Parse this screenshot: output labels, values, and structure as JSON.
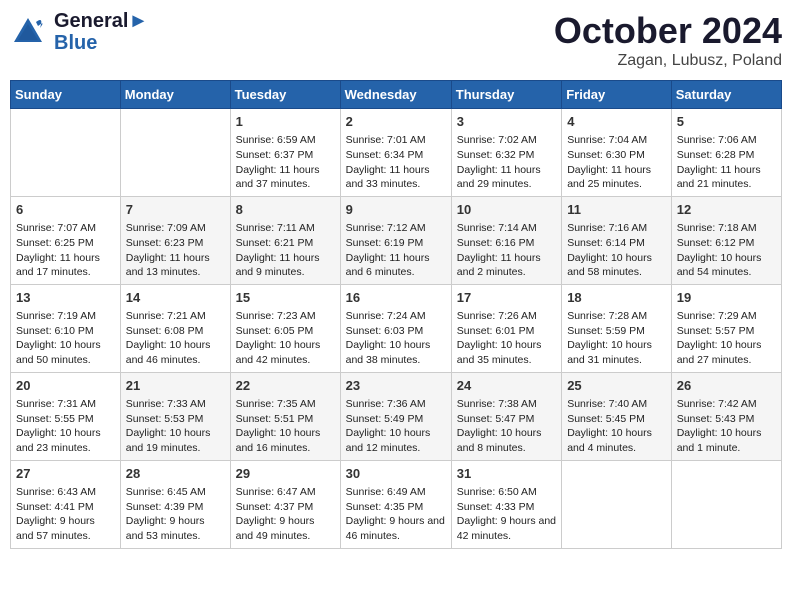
{
  "header": {
    "logo_general": "General",
    "logo_blue": "Blue",
    "month_title": "October 2024",
    "location": "Zagan, Lubusz, Poland"
  },
  "days_of_week": [
    "Sunday",
    "Monday",
    "Tuesday",
    "Wednesday",
    "Thursday",
    "Friday",
    "Saturday"
  ],
  "weeks": [
    [
      {
        "day": "",
        "info": ""
      },
      {
        "day": "",
        "info": ""
      },
      {
        "day": "1",
        "info": "Sunrise: 6:59 AM\nSunset: 6:37 PM\nDaylight: 11 hours and 37 minutes."
      },
      {
        "day": "2",
        "info": "Sunrise: 7:01 AM\nSunset: 6:34 PM\nDaylight: 11 hours and 33 minutes."
      },
      {
        "day": "3",
        "info": "Sunrise: 7:02 AM\nSunset: 6:32 PM\nDaylight: 11 hours and 29 minutes."
      },
      {
        "day": "4",
        "info": "Sunrise: 7:04 AM\nSunset: 6:30 PM\nDaylight: 11 hours and 25 minutes."
      },
      {
        "day": "5",
        "info": "Sunrise: 7:06 AM\nSunset: 6:28 PM\nDaylight: 11 hours and 21 minutes."
      }
    ],
    [
      {
        "day": "6",
        "info": "Sunrise: 7:07 AM\nSunset: 6:25 PM\nDaylight: 11 hours and 17 minutes."
      },
      {
        "day": "7",
        "info": "Sunrise: 7:09 AM\nSunset: 6:23 PM\nDaylight: 11 hours and 13 minutes."
      },
      {
        "day": "8",
        "info": "Sunrise: 7:11 AM\nSunset: 6:21 PM\nDaylight: 11 hours and 9 minutes."
      },
      {
        "day": "9",
        "info": "Sunrise: 7:12 AM\nSunset: 6:19 PM\nDaylight: 11 hours and 6 minutes."
      },
      {
        "day": "10",
        "info": "Sunrise: 7:14 AM\nSunset: 6:16 PM\nDaylight: 11 hours and 2 minutes."
      },
      {
        "day": "11",
        "info": "Sunrise: 7:16 AM\nSunset: 6:14 PM\nDaylight: 10 hours and 58 minutes."
      },
      {
        "day": "12",
        "info": "Sunrise: 7:18 AM\nSunset: 6:12 PM\nDaylight: 10 hours and 54 minutes."
      }
    ],
    [
      {
        "day": "13",
        "info": "Sunrise: 7:19 AM\nSunset: 6:10 PM\nDaylight: 10 hours and 50 minutes."
      },
      {
        "day": "14",
        "info": "Sunrise: 7:21 AM\nSunset: 6:08 PM\nDaylight: 10 hours and 46 minutes."
      },
      {
        "day": "15",
        "info": "Sunrise: 7:23 AM\nSunset: 6:05 PM\nDaylight: 10 hours and 42 minutes."
      },
      {
        "day": "16",
        "info": "Sunrise: 7:24 AM\nSunset: 6:03 PM\nDaylight: 10 hours and 38 minutes."
      },
      {
        "day": "17",
        "info": "Sunrise: 7:26 AM\nSunset: 6:01 PM\nDaylight: 10 hours and 35 minutes."
      },
      {
        "day": "18",
        "info": "Sunrise: 7:28 AM\nSunset: 5:59 PM\nDaylight: 10 hours and 31 minutes."
      },
      {
        "day": "19",
        "info": "Sunrise: 7:29 AM\nSunset: 5:57 PM\nDaylight: 10 hours and 27 minutes."
      }
    ],
    [
      {
        "day": "20",
        "info": "Sunrise: 7:31 AM\nSunset: 5:55 PM\nDaylight: 10 hours and 23 minutes."
      },
      {
        "day": "21",
        "info": "Sunrise: 7:33 AM\nSunset: 5:53 PM\nDaylight: 10 hours and 19 minutes."
      },
      {
        "day": "22",
        "info": "Sunrise: 7:35 AM\nSunset: 5:51 PM\nDaylight: 10 hours and 16 minutes."
      },
      {
        "day": "23",
        "info": "Sunrise: 7:36 AM\nSunset: 5:49 PM\nDaylight: 10 hours and 12 minutes."
      },
      {
        "day": "24",
        "info": "Sunrise: 7:38 AM\nSunset: 5:47 PM\nDaylight: 10 hours and 8 minutes."
      },
      {
        "day": "25",
        "info": "Sunrise: 7:40 AM\nSunset: 5:45 PM\nDaylight: 10 hours and 4 minutes."
      },
      {
        "day": "26",
        "info": "Sunrise: 7:42 AM\nSunset: 5:43 PM\nDaylight: 10 hours and 1 minute."
      }
    ],
    [
      {
        "day": "27",
        "info": "Sunrise: 6:43 AM\nSunset: 4:41 PM\nDaylight: 9 hours and 57 minutes."
      },
      {
        "day": "28",
        "info": "Sunrise: 6:45 AM\nSunset: 4:39 PM\nDaylight: 9 hours and 53 minutes."
      },
      {
        "day": "29",
        "info": "Sunrise: 6:47 AM\nSunset: 4:37 PM\nDaylight: 9 hours and 49 minutes."
      },
      {
        "day": "30",
        "info": "Sunrise: 6:49 AM\nSunset: 4:35 PM\nDaylight: 9 hours and 46 minutes."
      },
      {
        "day": "31",
        "info": "Sunrise: 6:50 AM\nSunset: 4:33 PM\nDaylight: 9 hours and 42 minutes."
      },
      {
        "day": "",
        "info": ""
      },
      {
        "day": "",
        "info": ""
      }
    ]
  ]
}
